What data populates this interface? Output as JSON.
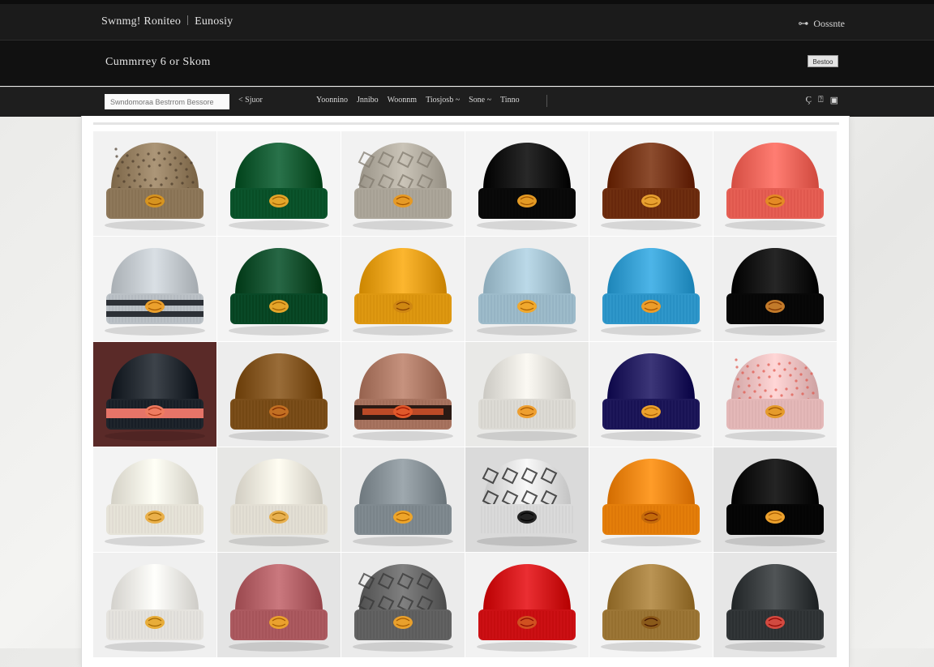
{
  "header": {
    "brand": "Swnmg! Roniteo",
    "brand_secondary": "Eunosiy",
    "account_icon": "user-icon",
    "account_label": "Oossnte"
  },
  "hero": {
    "title": "Cummrrey 6 or Skom",
    "button_label": "Bestoo"
  },
  "nav": {
    "search_placeholder": "Swndomoraa Bestrrom Bessore",
    "search_link": "< Sjuor",
    "links": [
      "Yoonnino",
      "Jnnibo",
      "Woonnm",
      "Tiosjosb ~",
      "Sone ~",
      "Tinno"
    ],
    "icons": [
      "search-icon",
      "bag-icon",
      "menu-icon"
    ]
  },
  "products": [
    {
      "color": "#9a8466",
      "accent": "#d69420",
      "bg": "#f2f2f2",
      "pattern": "speckle"
    },
    {
      "color": "#176038",
      "accent": "#e4a52a",
      "bg": "#f5f5f5",
      "pattern": "plain"
    },
    {
      "color": "#b8b2a6",
      "accent": "#e69a25",
      "bg": "#f2f2f2",
      "pattern": "snake"
    },
    {
      "color": "#161616",
      "accent": "#e49a24",
      "bg": "#f4f4f4",
      "pattern": "plain"
    },
    {
      "color": "#7a3a1c",
      "accent": "#e7a030",
      "bg": "#f4f4f4",
      "pattern": "plain"
    },
    {
      "color": "#f26b60",
      "accent": "#e48a25",
      "bg": "#f2f2f2",
      "pattern": "plain"
    },
    {
      "color": "#c7cdd2",
      "accent": "#eba02d",
      "bg": "#f3f3f3",
      "pattern": "stripe"
    },
    {
      "color": "#155533",
      "accent": "#e4a52a",
      "bg": "#f4f4f4",
      "pattern": "plain"
    },
    {
      "color": "#eaa41d",
      "accent": "#cf8712",
      "bg": "#f2f2f2",
      "pattern": "plain"
    },
    {
      "color": "#a9c7d6",
      "accent": "#f0a82d",
      "bg": "#eeeeee",
      "pattern": "plain"
    },
    {
      "color": "#3ba3d6",
      "accent": "#ec9d2a",
      "bg": "#f3f3f3",
      "pattern": "plain"
    },
    {
      "color": "#141414",
      "accent": "#c27a2a",
      "bg": "#eeeeee",
      "pattern": "plain"
    },
    {
      "color": "#2b3138",
      "accent": "#ee7b60",
      "bg": "#5a2a28",
      "pattern": "dark"
    },
    {
      "color": "#875a26",
      "accent": "#c26f22",
      "bg": "#ededed",
      "pattern": "plain"
    },
    {
      "color": "#b4806c",
      "accent": "#e0582a",
      "bg": "#f2f2f2",
      "pattern": "band"
    },
    {
      "color": "#e9e7e1",
      "accent": "#ee9f30",
      "bg": "#e9e9e7",
      "pattern": "plain"
    },
    {
      "color": "#2a2466",
      "accent": "#eca12d",
      "bg": "#f2f2f2",
      "pattern": "plain"
    },
    {
      "color": "#f0c4c4",
      "accent": "#e59b2b",
      "bg": "#f2f2f2",
      "pattern": "speckle-red"
    },
    {
      "color": "#f2efe4",
      "accent": "#eab04a",
      "bg": "#f3f3f3",
      "pattern": "plain"
    },
    {
      "color": "#efebe0",
      "accent": "#e8b04f",
      "bg": "#e7e7e5",
      "pattern": "plain"
    },
    {
      "color": "#8c969c",
      "accent": "#eea52a",
      "bg": "#ebebeb",
      "pattern": "plain"
    },
    {
      "color": "#e6e6e6",
      "accent": "#222222",
      "bg": "#dadada",
      "pattern": "camo"
    },
    {
      "color": "#f08a16",
      "accent": "#c46a0a",
      "bg": "#f2f2f2",
      "pattern": "plain"
    },
    {
      "color": "#121212",
      "accent": "#eca12d",
      "bg": "#e0e0e0",
      "pattern": "plain"
    },
    {
      "color": "#f1efea",
      "accent": "#e8ad3a",
      "bg": "#f0f0f0",
      "pattern": "plain"
    },
    {
      "color": "#b8666c",
      "accent": "#eaa12e",
      "bg": "#e4e4e4",
      "pattern": "plain"
    },
    {
      "color": "#6e6e6e",
      "accent": "#e8a02c",
      "bg": "#ebebeb",
      "pattern": "snake"
    },
    {
      "color": "#d81c20",
      "accent": "#d05020",
      "bg": "#f2f2f2",
      "pattern": "plain"
    },
    {
      "color": "#a88242",
      "accent": "#8a5a1a",
      "bg": "#f4f4f4",
      "pattern": "plain"
    },
    {
      "color": "#3e4244",
      "accent": "#d24a40",
      "bg": "#e6e6e6",
      "pattern": "plain"
    }
  ]
}
